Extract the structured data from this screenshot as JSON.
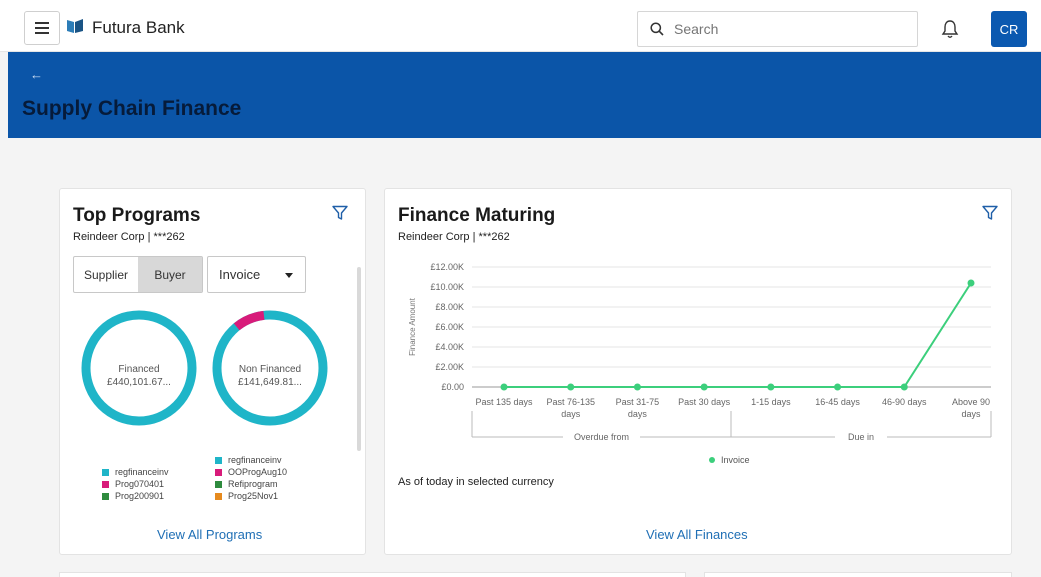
{
  "app": {
    "brand": "Futura Bank",
    "search_placeholder": "Search",
    "avatar_initials": "CR",
    "accent": "#0b55a8"
  },
  "banner": {
    "back": "←",
    "title": "Supply Chain Finance"
  },
  "top_programs": {
    "title": "Top Programs",
    "account": "Reindeer Corp | ***262",
    "toggle": [
      "Supplier",
      "Buyer"
    ],
    "toggle_selected": "Buyer",
    "dropdown_value": "Invoice",
    "financed": {
      "label": "Financed",
      "amount": "£440,101.67...",
      "fill": 1.0
    },
    "non_financed": {
      "label": "Non Financed",
      "amount": "£141,649.81...",
      "highlight_fraction": 0.09
    },
    "legend_left": [
      {
        "label": "regfinanceinv",
        "color": "#1fb5c8"
      },
      {
        "label": "Prog070401",
        "color": "#d81b7a"
      },
      {
        "label": "Prog200901",
        "color": "#2e8b3e"
      }
    ],
    "legend_right": [
      {
        "label": "regfinanceinv",
        "color": "#1fb5c8"
      },
      {
        "label": "OOProgAug10",
        "color": "#d81b7a"
      },
      {
        "label": "Refiprogram",
        "color": "#2e8b3e"
      },
      {
        "label": "Prog25Nov1",
        "color": "#e68a1e"
      }
    ],
    "link": "View All Programs"
  },
  "finance_maturing": {
    "title": "Finance Maturing",
    "account": "Reindeer Corp | ***262",
    "as_of": "As of today in selected currency",
    "link": "View All Finances",
    "chart_data": {
      "type": "line",
      "ylabel": "Finance Amount",
      "y_ticks": [
        "£0.00",
        "£2.00K",
        "£4.00K",
        "£6.00K",
        "£8.00K",
        "£10.00K",
        "£12.00K"
      ],
      "ylim": [
        0,
        12000
      ],
      "categories": [
        [
          "Past 135 days"
        ],
        [
          "Past 76-135",
          "days"
        ],
        [
          "Past 31-75",
          "days"
        ],
        [
          "Past 30 days"
        ],
        [
          "1-15 days"
        ],
        [
          "16-45 days"
        ],
        [
          "46-90 days"
        ],
        [
          "Above 90",
          "days"
        ]
      ],
      "groups": [
        {
          "label": "Overdue from",
          "span": 4
        },
        {
          "label": "Due in",
          "span": 4
        }
      ],
      "series": [
        {
          "name": "Invoice",
          "color": "#3ccf7c",
          "values": [
            0,
            0,
            0,
            0,
            0,
            0,
            0,
            10400
          ]
        }
      ],
      "grid": true,
      "legend": "bottom"
    }
  }
}
